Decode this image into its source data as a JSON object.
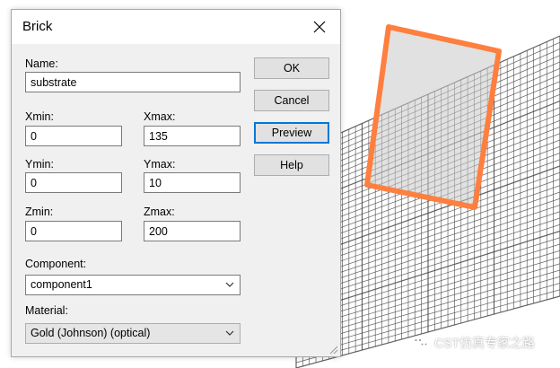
{
  "dialog": {
    "title": "Brick",
    "close_icon": "close-icon",
    "name_label": "Name:",
    "name_value": "substrate",
    "xmin_label": "Xmin:",
    "xmin_value": "0",
    "xmax_label": "Xmax:",
    "xmax_value": "135",
    "ymin_label": "Ymin:",
    "ymin_value": "0",
    "ymax_label": "Ymax:",
    "ymax_value": "10",
    "zmin_label": "Zmin:",
    "zmin_value": "0",
    "zmax_label": "Zmax:",
    "zmax_value": "200",
    "component_label": "Component:",
    "component_value": "component1",
    "material_label": "Material:",
    "material_value": "Gold (Johnson) (optical)"
  },
  "buttons": {
    "ok": "OK",
    "cancel": "Cancel",
    "preview": "Preview",
    "help": "Help"
  },
  "watermark": {
    "text": "CST仿真专家之路",
    "icon": "wechat-icon"
  },
  "colors": {
    "preview_outline": "#ff7f3f",
    "grid_line": "#4a4a4a",
    "default_button_border": "#0078d7"
  }
}
